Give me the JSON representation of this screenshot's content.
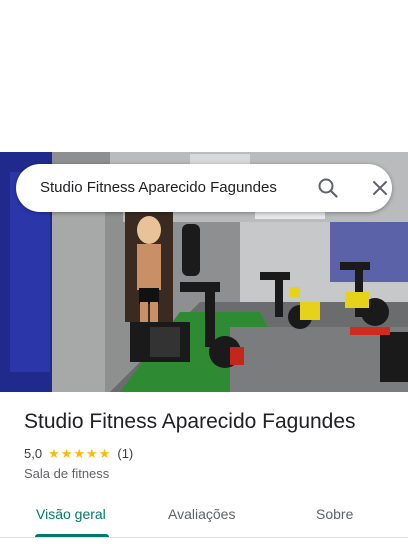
{
  "search": {
    "query": "Studio Fitness Aparecido Fagundes",
    "search_icon": "search-icon",
    "close_icon": "close-icon"
  },
  "place": {
    "name": "Studio Fitness Aparecido Fagundes",
    "rating": "5,0",
    "stars": 5,
    "review_count": "(1)",
    "category": "Sala de fitness"
  },
  "tabs": [
    {
      "label": "Visão geral",
      "active": true
    },
    {
      "label": "Avaliações",
      "active": false
    },
    {
      "label": "Sobre",
      "active": false
    }
  ],
  "colors": {
    "accent": "#00796b",
    "star": "#fbbc04"
  }
}
